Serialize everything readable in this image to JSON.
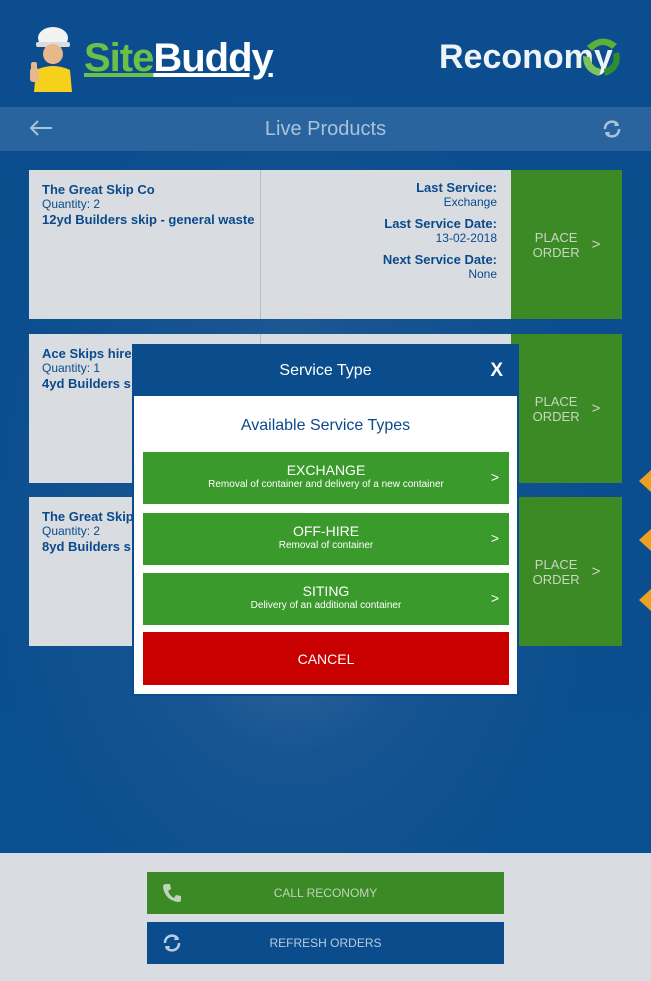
{
  "header": {
    "logo_left_part1": "Site",
    "logo_left_part2": "Buddy",
    "logo_right": "Reconomy"
  },
  "subheader": {
    "title": "Live Products",
    "back_icon": "arrow-left-icon",
    "refresh_icon": "refresh-icon"
  },
  "cards": [
    {
      "company": "The Great Skip Co",
      "quantity": "Quantity: 2",
      "product": "12yd Builders skip - general waste",
      "last_service_label": "Last Service:",
      "last_service": "Exchange",
      "last_date_label": "Last Service Date:",
      "last_date": "13-02-2018",
      "next_date_label": "Next Service Date:",
      "next_date": "None",
      "order_line1": "PLACE",
      "order_line2": "ORDER",
      "chev": ">"
    },
    {
      "company": "Ace Skips hire",
      "quantity": "Quantity: 1",
      "product": "4yd Builders s",
      "order_line1": "PLACE",
      "order_line2": "ORDER",
      "chev": ">"
    },
    {
      "company": "The Great Skip",
      "quantity": "Quantity: 2",
      "product": "8yd Builders s",
      "order_line1": "PLACE",
      "order_line2": "ORDER",
      "chev": ">"
    }
  ],
  "modal": {
    "title": "Service Type",
    "close": "X",
    "subtitle": "Available Service Types",
    "options": [
      {
        "name": "EXCHANGE",
        "desc": "Removal of container and delivery of a new container",
        "chev": ">"
      },
      {
        "name": "OFF-HIRE",
        "desc": "Removal of container",
        "chev": ">"
      },
      {
        "name": "SITING",
        "desc": "Delivery of an additional container",
        "chev": ">"
      }
    ],
    "cancel": "CANCEL"
  },
  "footer": {
    "call": "CALL RECONOMY",
    "refresh": "REFRESH ORDERS"
  },
  "colors": {
    "primary_blue": "#0a4c8c",
    "action_green": "#3b9a2c",
    "cancel_red": "#c80000",
    "accent_orange": "#f0a020"
  }
}
